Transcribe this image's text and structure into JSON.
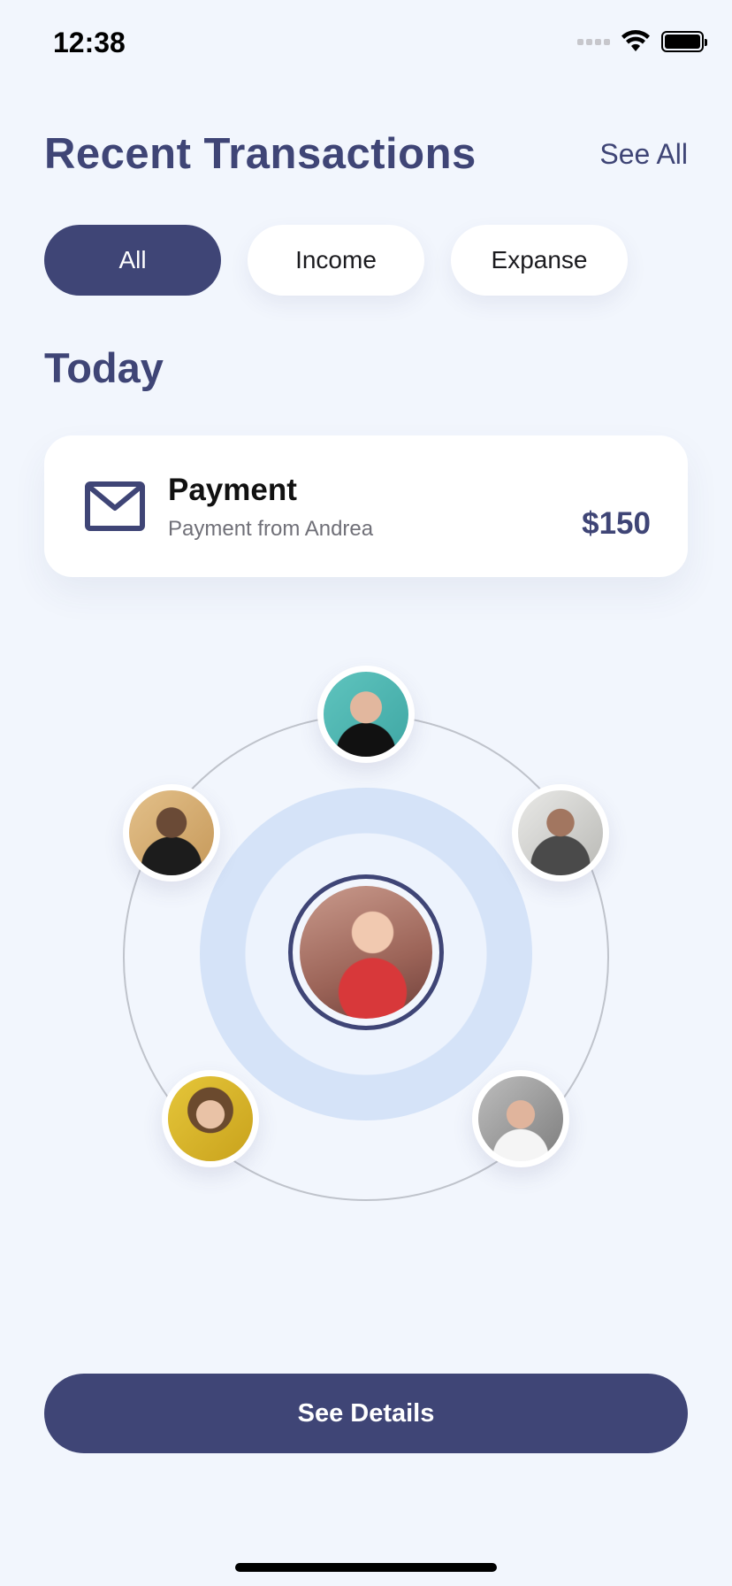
{
  "status_bar": {
    "time": "12:38"
  },
  "header": {
    "title": "Recent Transactions",
    "see_all": "See All"
  },
  "filters": [
    {
      "label": "All",
      "active": true
    },
    {
      "label": "Income",
      "active": false
    },
    {
      "label": "Expanse",
      "active": false
    }
  ],
  "section": {
    "title": "Today"
  },
  "transaction": {
    "icon": "mail-icon",
    "title": "Payment",
    "subtitle": "Payment from Andrea",
    "amount": "$150"
  },
  "contacts": {
    "center": "center-avatar",
    "orbit": [
      "avatar-top",
      "avatar-left",
      "avatar-right",
      "avatar-bottom-left",
      "avatar-bottom-right"
    ]
  },
  "actions": {
    "see_details": "See Details"
  },
  "colors": {
    "primary": "#3F4576",
    "background": "#F2F6FD",
    "halo": "#D5E3F8",
    "card": "#FFFFFF"
  }
}
